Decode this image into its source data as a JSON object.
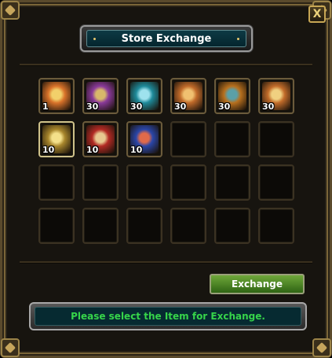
{
  "window": {
    "title": "Store Exchange",
    "close_label": "X"
  },
  "grid": {
    "columns": 6,
    "rows": 4,
    "slots": [
      {
        "icon": "sun-medallion-icon",
        "qty": "1",
        "color": "#d9732a",
        "accent": "#f2d06a",
        "selected": false
      },
      {
        "icon": "armor-scroll-icon",
        "qty": "30",
        "color": "#8a3a9a",
        "accent": "#d8b86a",
        "selected": false
      },
      {
        "icon": "blue-sword-icon",
        "qty": "30",
        "color": "#1e8a9a",
        "accent": "#9ee2ee",
        "selected": false
      },
      {
        "icon": "map-scroll-icon",
        "qty": "30",
        "color": "#c06a2a",
        "accent": "#f0c070",
        "selected": false
      },
      {
        "icon": "horn-icon",
        "qty": "30",
        "color": "#b8701e",
        "accent": "#5aa0a8",
        "selected": false
      },
      {
        "icon": "hammer-icon",
        "qty": "30",
        "color": "#c26c2a",
        "accent": "#f0d080",
        "selected": false
      },
      {
        "icon": "gold-scroll-icon",
        "qty": "10",
        "color": "#a8862c",
        "accent": "#f4e08a",
        "selected": true
      },
      {
        "icon": "red-pouch-icon",
        "qty": "10",
        "color": "#b22a24",
        "accent": "#e8c890",
        "selected": false
      },
      {
        "icon": "blue-pouch-icon",
        "qty": "10",
        "color": "#2a46a8",
        "accent": "#e06a4a",
        "selected": false
      }
    ]
  },
  "exchange_button": "Exchange",
  "message": "Please select the Item for Exchange."
}
